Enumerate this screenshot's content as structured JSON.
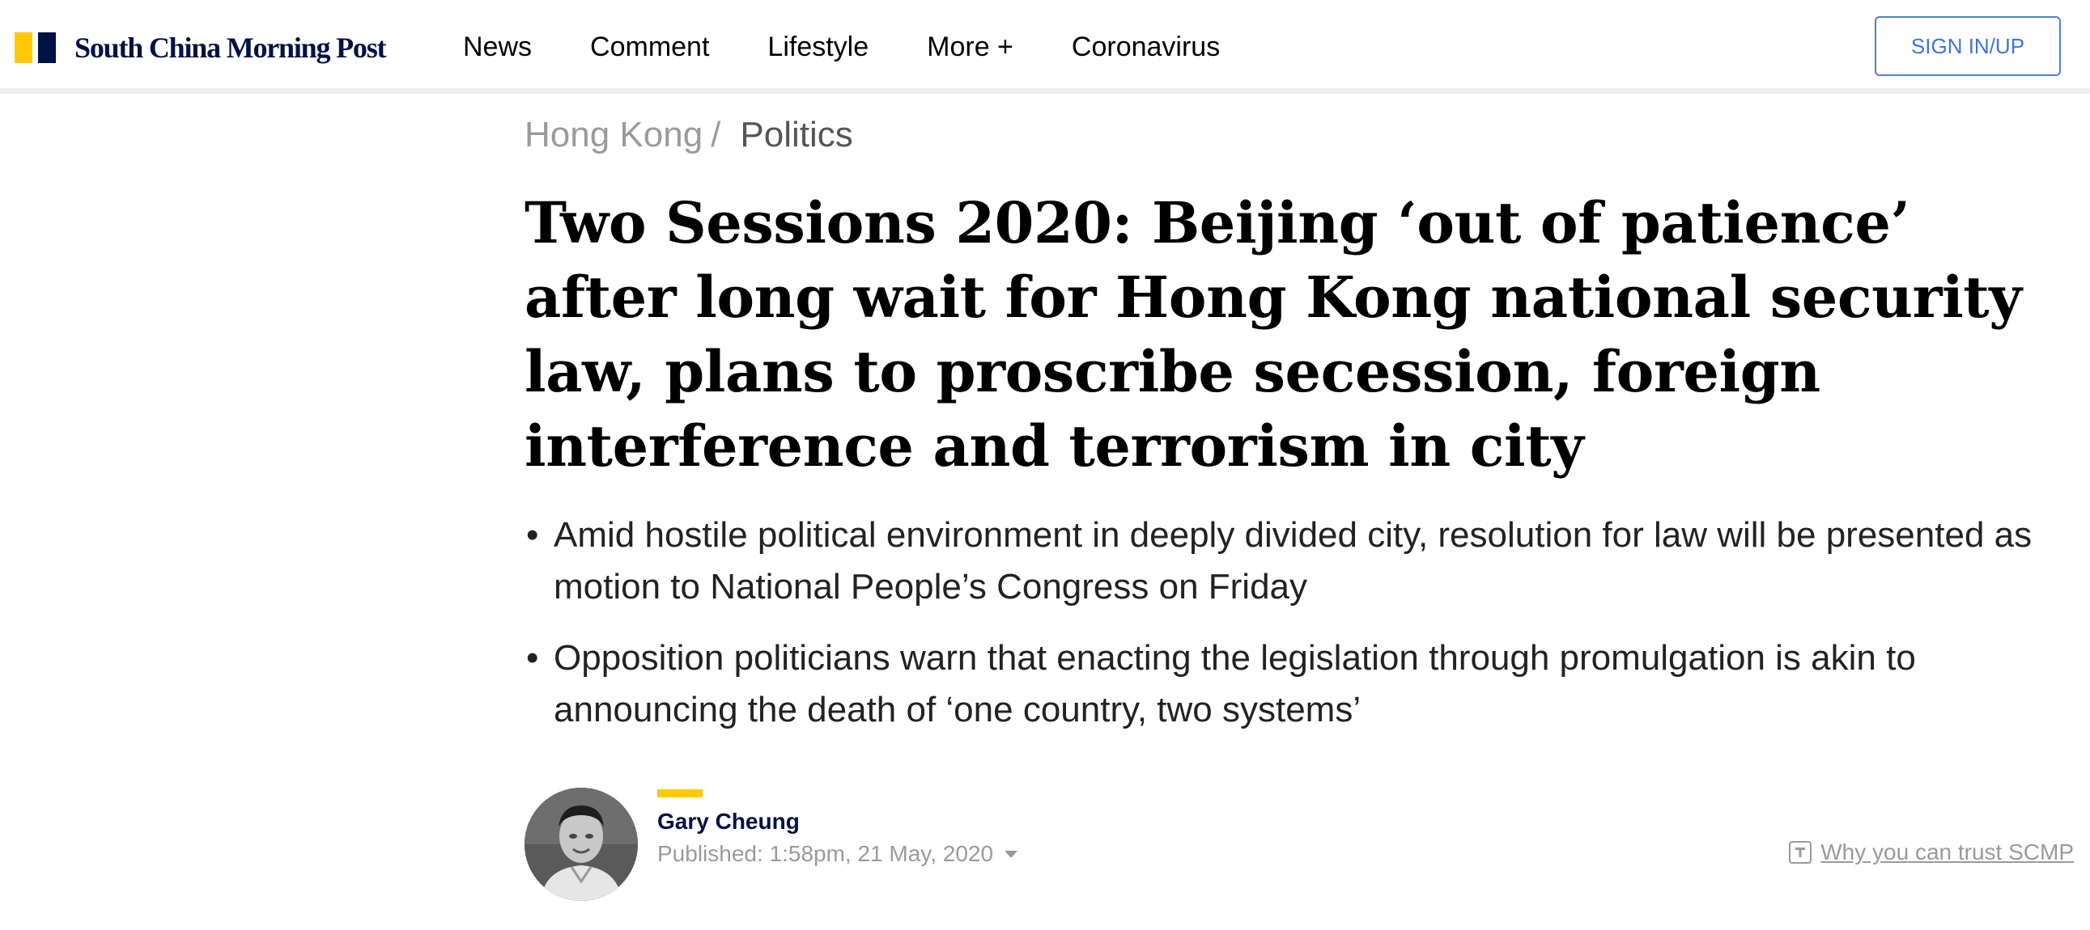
{
  "header": {
    "logo_text": "South China Morning Post",
    "nav": [
      "News",
      "Comment",
      "Lifestyle",
      "More +",
      "Coronavirus"
    ],
    "signin_label": "SIGN IN/UP"
  },
  "breadcrumb": {
    "parent": "Hong Kong",
    "separator": "/",
    "current": "Politics"
  },
  "article": {
    "headline": "Two Sessions 2020: Beijing ‘out of patience’ after long wait for Hong Kong national security law, plans to proscribe secession, foreign interference and terrorism in city",
    "summary": [
      "Amid hostile political environment in deeply divided city, resolution for law will be presented as motion to National People’s Congress on Friday",
      "Opposition politicians warn that enacting the legislation through promulgation is akin to announcing the death of ‘one country, two systems’"
    ],
    "bullet": "•"
  },
  "byline": {
    "author": "Gary Cheung",
    "published": "Published: 1:58pm, 21 May, 2020",
    "trust_label": "Why you can trust SCMP"
  },
  "colors": {
    "brand_navy": "#001246",
    "brand_yellow": "#ffca05",
    "signin_blue": "#3f75d8"
  },
  "icons": {
    "logo": "scmp-logo-mark",
    "trust": "trust-badge-icon",
    "published_toggle": "caret-down-icon"
  }
}
